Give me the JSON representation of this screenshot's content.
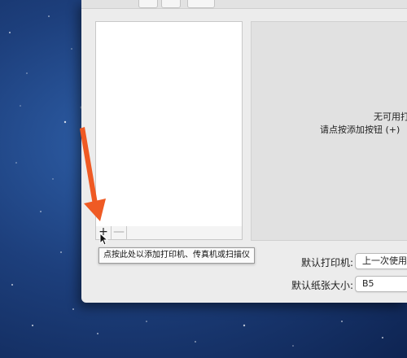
{
  "printer_list": {
    "items": []
  },
  "list_controls": {
    "add_label": "+",
    "remove_label": "—"
  },
  "tooltip": {
    "text": "点按此处以添加打印机、传真机或扫描仪"
  },
  "detail": {
    "no_printer_text": "无可用打",
    "hint_text": "请点按添加按钮 (+)"
  },
  "settings": {
    "default_printer_label": "默认打印机:",
    "default_printer_value": "上一次使用",
    "default_paper_label": "默认纸张大小:",
    "default_paper_value": "B5"
  },
  "colors": {
    "annotation_arrow": "#ef5a24",
    "window_bg": "#ececec"
  }
}
